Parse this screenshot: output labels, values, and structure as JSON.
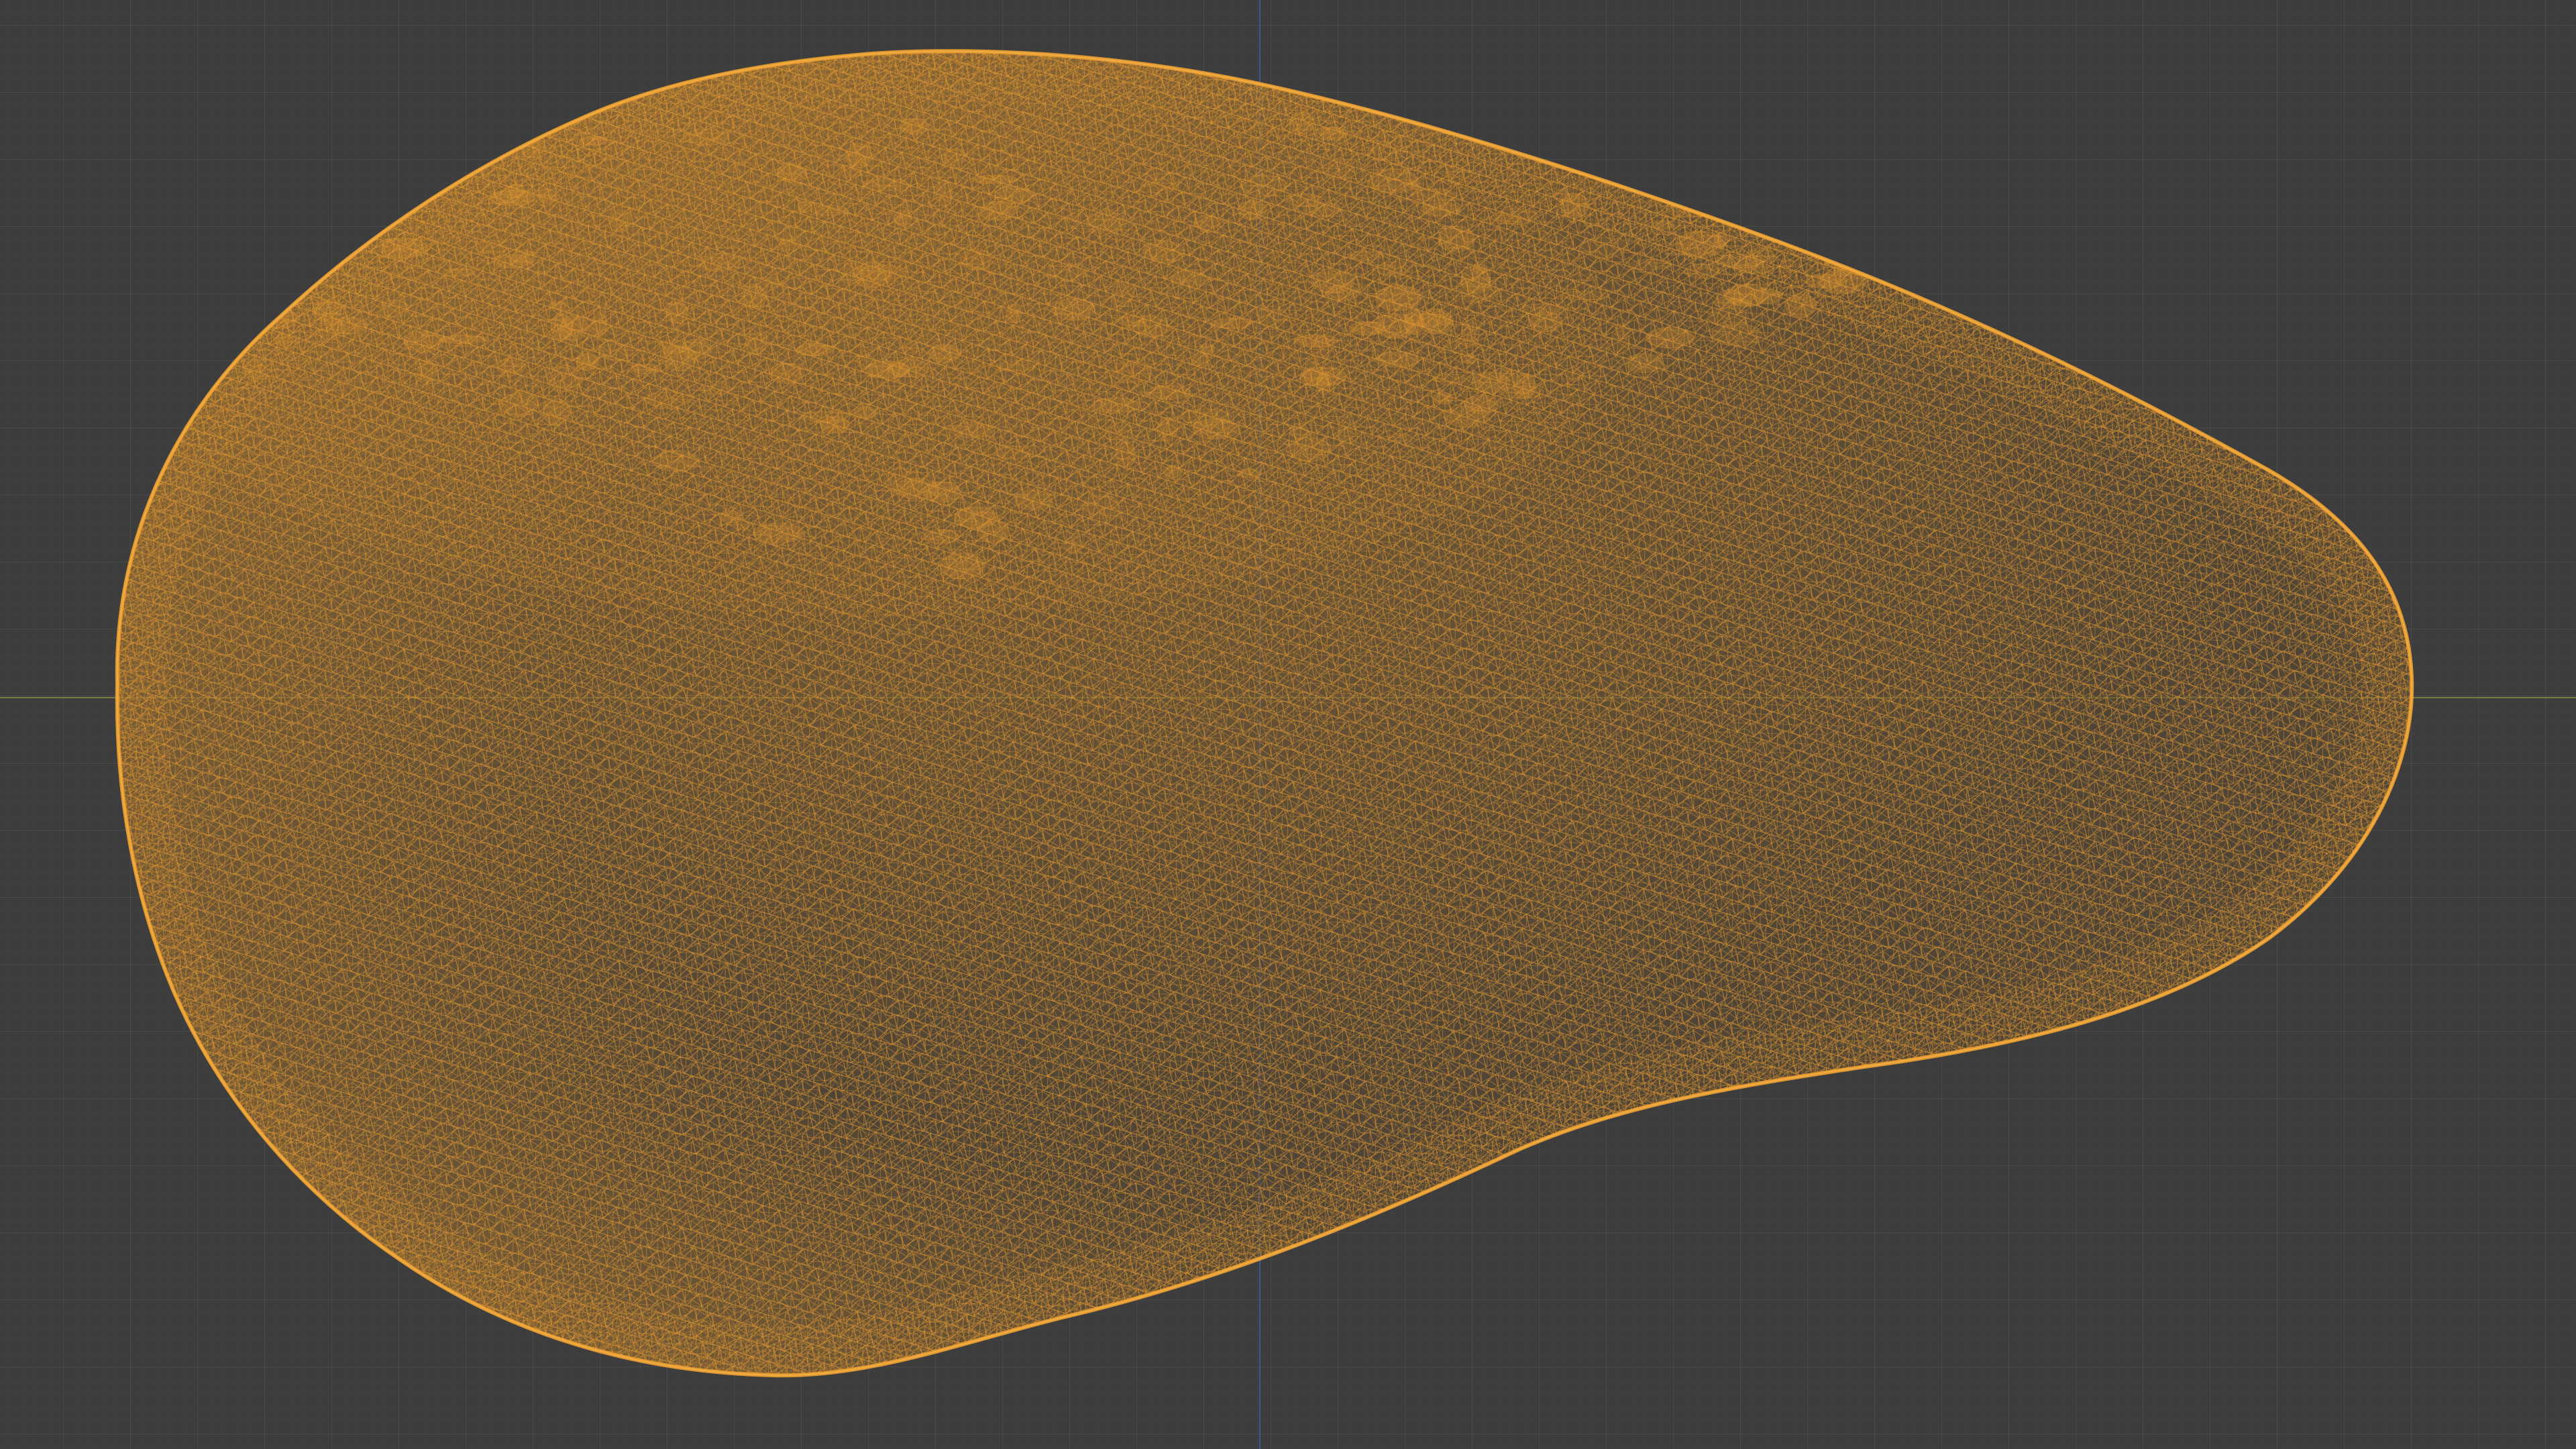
{
  "viewport": {
    "mode": "wireframe",
    "background_color": "#3d3d3d",
    "grid_color": "#4a4a4a"
  },
  "axes": {
    "x_axis_color": "#7a7b3c",
    "y_axis_color": "#3b5a8c"
  },
  "object": {
    "shape": "avocado",
    "display": "wireframe",
    "selected": true,
    "wire_color": "#f0a030",
    "fill_color": "#5e4a30"
  }
}
